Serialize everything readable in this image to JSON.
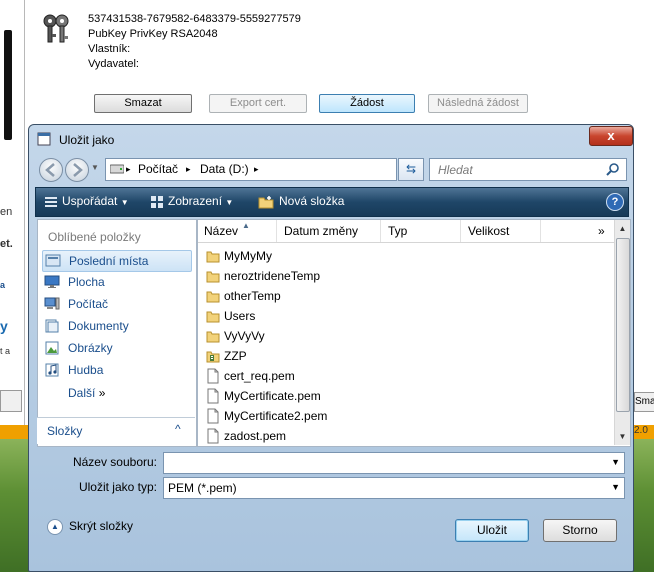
{
  "background": {
    "certificate": {
      "serial": "537431538-7679582-6483379-5559277579",
      "key_info": "PubKey PrivKey  RSA2048",
      "owner_label": "Vlastník:",
      "issuer_label": "Vydavatel:"
    },
    "buttons": {
      "delete": "Smazat",
      "export": "Export cert.",
      "request": "Žádost",
      "next_request": "Následná žádost"
    },
    "left_fragments": [
      "en",
      "et.",
      "a",
      "y",
      "t a"
    ],
    "right_fragment": "Sma",
    "orange_fragment": "2.0"
  },
  "dialog": {
    "title": "Uložit jako",
    "close_glyph": "x",
    "address": {
      "crumbs": [
        "Počítač",
        "Data (D:)"
      ],
      "separator": "▸"
    },
    "search_placeholder": "Hledat",
    "toolbar": {
      "organize": "Uspořádat",
      "views": "Zobrazení",
      "new_folder": "Nová složka",
      "help": "?"
    },
    "nav": {
      "favorites_header": "Oblíbené položky",
      "items": [
        {
          "label": "Poslední místa",
          "icon": "recent-places-icon"
        },
        {
          "label": "Plocha",
          "icon": "desktop-icon"
        },
        {
          "label": "Počítač",
          "icon": "computer-icon"
        },
        {
          "label": "Dokumenty",
          "icon": "documents-icon"
        },
        {
          "label": "Obrázky",
          "icon": "pictures-icon"
        },
        {
          "label": "Hudba",
          "icon": "music-icon"
        }
      ],
      "more": "Další",
      "more_glyph": "»",
      "folders": "Složky",
      "folders_glyph": "^"
    },
    "columns": [
      "Název",
      "Datum změny",
      "Typ",
      "Velikost"
    ],
    "columns_more": "»",
    "files": [
      {
        "name": "MyMyMy",
        "type": "folder"
      },
      {
        "name": "neroztrideneTemp",
        "type": "folder"
      },
      {
        "name": "otherTemp",
        "type": "folder"
      },
      {
        "name": "Users",
        "type": "folder"
      },
      {
        "name": "VyVyVy",
        "type": "folder"
      },
      {
        "name": "ZZP",
        "type": "zip-folder"
      },
      {
        "name": "cert_req.pem",
        "type": "file"
      },
      {
        "name": "MyCertificate.pem",
        "type": "file"
      },
      {
        "name": "MyCertificate2.pem",
        "type": "file"
      },
      {
        "name": "zadost.pem",
        "type": "file"
      }
    ],
    "form": {
      "filename_label": "Název souboru:",
      "filename_value": "",
      "filetype_label": "Uložit jako typ:",
      "filetype_value": "PEM (*.pem)"
    },
    "hide_folders": "Skrýt složky",
    "save_button": "Uložit",
    "cancel_button": "Storno"
  },
  "colors": {
    "toolbar": "#1f4668",
    "link": "#1a4e8c",
    "orange_bar": "#f0a000"
  }
}
